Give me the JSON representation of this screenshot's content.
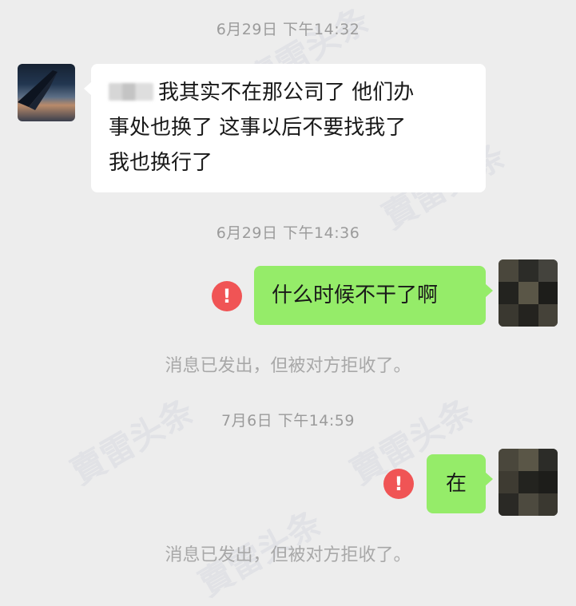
{
  "chat": {
    "messages": [
      {
        "timestamp": "6月29日 下午14:32",
        "text_line1": "我其实不在那公司了 他们办",
        "text_line2": "事处也换了 这事以后不要找我了",
        "text_line3": "我也换行了"
      },
      {
        "timestamp": "6月29日 下午14:36",
        "text": "什么时候不干了啊",
        "notice": "消息已发出，但被对方拒收了。"
      },
      {
        "timestamp": "7月6日 下午14:59",
        "text": "在",
        "notice": "消息已发出，但被对方拒收了。"
      }
    ],
    "error_icon_glyph": "!",
    "watermark_text": "賣雷头条"
  },
  "colors": {
    "background": "#ededed",
    "sent_bubble": "#95ec69",
    "received_bubble": "#ffffff",
    "error_red": "#f05455"
  }
}
